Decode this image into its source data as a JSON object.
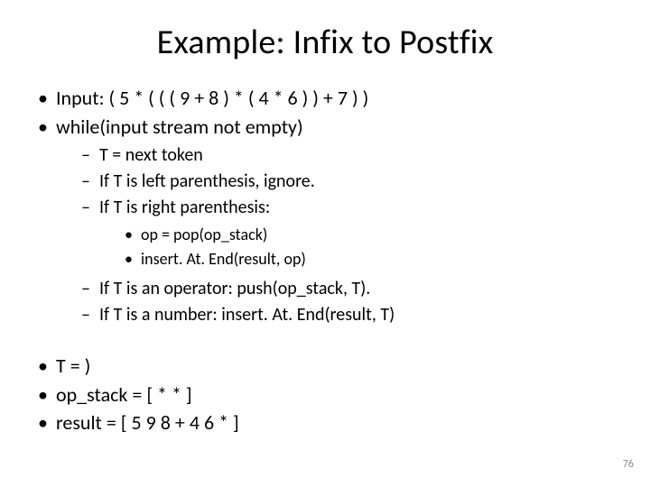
{
  "title": "Example: Infix to Postfix",
  "bullets": {
    "b0": "Input: ( 5 * ( ( ( 9 + 8 ) *  ( 4 * 6 ) ) + 7 ) )",
    "b1": "while(input stream not empty)",
    "b1_children": {
      "c0": "T = next token",
      "c1": "If T is left parenthesis, ignore.",
      "c2": "If T is right parenthesis:",
      "c2_children": {
        "d0": "op = pop(op_stack)",
        "d1": "insert. At. End(result, op)"
      },
      "c3": "If T is an operator:  push(op_stack, T).",
      "c4": "If T is a number: insert. At. End(result, T)"
    },
    "b2": "T = )",
    "b3": "op_stack = [  *  *  ]",
    "b4": "result = [  5  9  8  +  4  6  *  ]"
  },
  "page_number": "76"
}
